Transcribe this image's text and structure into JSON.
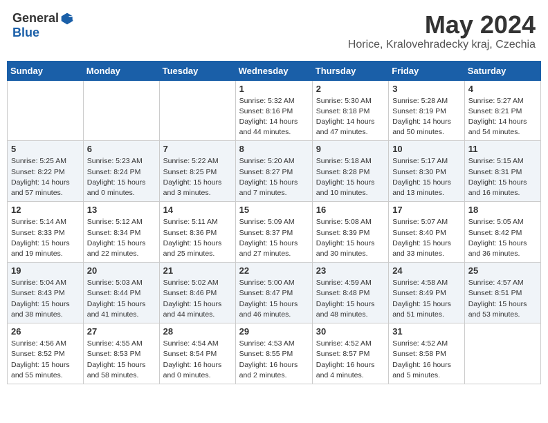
{
  "header": {
    "logo_general": "General",
    "logo_blue": "Blue",
    "month_title": "May 2024",
    "location": "Horice, Kralovehradecky kraj, Czechia"
  },
  "weekdays": [
    "Sunday",
    "Monday",
    "Tuesday",
    "Wednesday",
    "Thursday",
    "Friday",
    "Saturday"
  ],
  "weeks": [
    [
      {
        "day": "",
        "info": ""
      },
      {
        "day": "",
        "info": ""
      },
      {
        "day": "",
        "info": ""
      },
      {
        "day": "1",
        "info": "Sunrise: 5:32 AM\nSunset: 8:16 PM\nDaylight: 14 hours\nand 44 minutes."
      },
      {
        "day": "2",
        "info": "Sunrise: 5:30 AM\nSunset: 8:18 PM\nDaylight: 14 hours\nand 47 minutes."
      },
      {
        "day": "3",
        "info": "Sunrise: 5:28 AM\nSunset: 8:19 PM\nDaylight: 14 hours\nand 50 minutes."
      },
      {
        "day": "4",
        "info": "Sunrise: 5:27 AM\nSunset: 8:21 PM\nDaylight: 14 hours\nand 54 minutes."
      }
    ],
    [
      {
        "day": "5",
        "info": "Sunrise: 5:25 AM\nSunset: 8:22 PM\nDaylight: 14 hours\nand 57 minutes."
      },
      {
        "day": "6",
        "info": "Sunrise: 5:23 AM\nSunset: 8:24 PM\nDaylight: 15 hours\nand 0 minutes."
      },
      {
        "day": "7",
        "info": "Sunrise: 5:22 AM\nSunset: 8:25 PM\nDaylight: 15 hours\nand 3 minutes."
      },
      {
        "day": "8",
        "info": "Sunrise: 5:20 AM\nSunset: 8:27 PM\nDaylight: 15 hours\nand 7 minutes."
      },
      {
        "day": "9",
        "info": "Sunrise: 5:18 AM\nSunset: 8:28 PM\nDaylight: 15 hours\nand 10 minutes."
      },
      {
        "day": "10",
        "info": "Sunrise: 5:17 AM\nSunset: 8:30 PM\nDaylight: 15 hours\nand 13 minutes."
      },
      {
        "day": "11",
        "info": "Sunrise: 5:15 AM\nSunset: 8:31 PM\nDaylight: 15 hours\nand 16 minutes."
      }
    ],
    [
      {
        "day": "12",
        "info": "Sunrise: 5:14 AM\nSunset: 8:33 PM\nDaylight: 15 hours\nand 19 minutes."
      },
      {
        "day": "13",
        "info": "Sunrise: 5:12 AM\nSunset: 8:34 PM\nDaylight: 15 hours\nand 22 minutes."
      },
      {
        "day": "14",
        "info": "Sunrise: 5:11 AM\nSunset: 8:36 PM\nDaylight: 15 hours\nand 25 minutes."
      },
      {
        "day": "15",
        "info": "Sunrise: 5:09 AM\nSunset: 8:37 PM\nDaylight: 15 hours\nand 27 minutes."
      },
      {
        "day": "16",
        "info": "Sunrise: 5:08 AM\nSunset: 8:39 PM\nDaylight: 15 hours\nand 30 minutes."
      },
      {
        "day": "17",
        "info": "Sunrise: 5:07 AM\nSunset: 8:40 PM\nDaylight: 15 hours\nand 33 minutes."
      },
      {
        "day": "18",
        "info": "Sunrise: 5:05 AM\nSunset: 8:42 PM\nDaylight: 15 hours\nand 36 minutes."
      }
    ],
    [
      {
        "day": "19",
        "info": "Sunrise: 5:04 AM\nSunset: 8:43 PM\nDaylight: 15 hours\nand 38 minutes."
      },
      {
        "day": "20",
        "info": "Sunrise: 5:03 AM\nSunset: 8:44 PM\nDaylight: 15 hours\nand 41 minutes."
      },
      {
        "day": "21",
        "info": "Sunrise: 5:02 AM\nSunset: 8:46 PM\nDaylight: 15 hours\nand 44 minutes."
      },
      {
        "day": "22",
        "info": "Sunrise: 5:00 AM\nSunset: 8:47 PM\nDaylight: 15 hours\nand 46 minutes."
      },
      {
        "day": "23",
        "info": "Sunrise: 4:59 AM\nSunset: 8:48 PM\nDaylight: 15 hours\nand 48 minutes."
      },
      {
        "day": "24",
        "info": "Sunrise: 4:58 AM\nSunset: 8:49 PM\nDaylight: 15 hours\nand 51 minutes."
      },
      {
        "day": "25",
        "info": "Sunrise: 4:57 AM\nSunset: 8:51 PM\nDaylight: 15 hours\nand 53 minutes."
      }
    ],
    [
      {
        "day": "26",
        "info": "Sunrise: 4:56 AM\nSunset: 8:52 PM\nDaylight: 15 hours\nand 55 minutes."
      },
      {
        "day": "27",
        "info": "Sunrise: 4:55 AM\nSunset: 8:53 PM\nDaylight: 15 hours\nand 58 minutes."
      },
      {
        "day": "28",
        "info": "Sunrise: 4:54 AM\nSunset: 8:54 PM\nDaylight: 16 hours\nand 0 minutes."
      },
      {
        "day": "29",
        "info": "Sunrise: 4:53 AM\nSunset: 8:55 PM\nDaylight: 16 hours\nand 2 minutes."
      },
      {
        "day": "30",
        "info": "Sunrise: 4:52 AM\nSunset: 8:57 PM\nDaylight: 16 hours\nand 4 minutes."
      },
      {
        "day": "31",
        "info": "Sunrise: 4:52 AM\nSunset: 8:58 PM\nDaylight: 16 hours\nand 5 minutes."
      },
      {
        "day": "",
        "info": ""
      }
    ]
  ]
}
